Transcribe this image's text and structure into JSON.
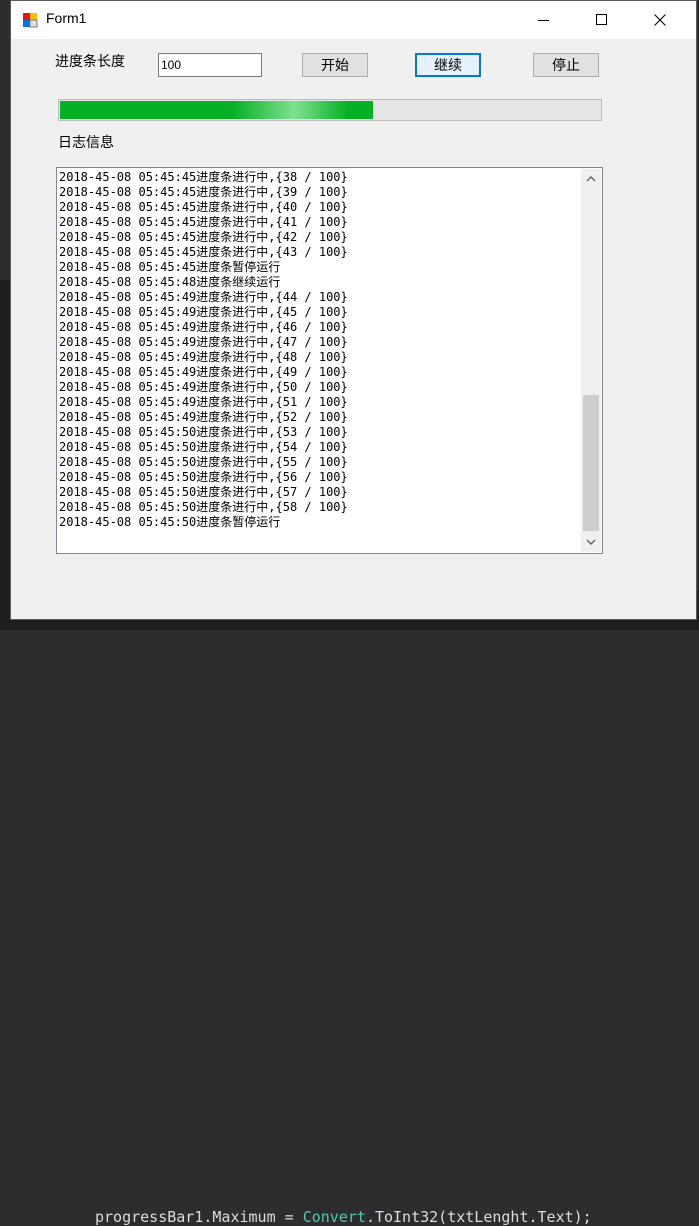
{
  "window": {
    "title": "Form1"
  },
  "controls": {
    "length_label": "进度条长度",
    "length_value": "100",
    "start_button": "开始",
    "continue_button": "继续",
    "stop_button": "停止",
    "log_label": "日志信息"
  },
  "progress": {
    "value": 58,
    "max": 100,
    "fraction": 0.58
  },
  "log": [
    "2018-45-08 05:45:45进度条进行中,{38 / 100}",
    "2018-45-08 05:45:45进度条进行中,{39 / 100}",
    "2018-45-08 05:45:45进度条进行中,{40 / 100}",
    "2018-45-08 05:45:45进度条进行中,{41 / 100}",
    "2018-45-08 05:45:45进度条进行中,{42 / 100}",
    "2018-45-08 05:45:45进度条进行中,{43 / 100}",
    "2018-45-08 05:45:45进度条暂停运行",
    "2018-45-08 05:45:48进度条继续运行",
    "2018-45-08 05:45:49进度条进行中,{44 / 100}",
    "2018-45-08 05:45:49进度条进行中,{45 / 100}",
    "2018-45-08 05:45:49进度条进行中,{46 / 100}",
    "2018-45-08 05:45:49进度条进行中,{47 / 100}",
    "2018-45-08 05:45:49进度条进行中,{48 / 100}",
    "2018-45-08 05:45:49进度条进行中,{49 / 100}",
    "2018-45-08 05:45:49进度条进行中,{50 / 100}",
    "2018-45-08 05:45:49进度条进行中,{51 / 100}",
    "2018-45-08 05:45:49进度条进行中,{52 / 100}",
    "2018-45-08 05:45:50进度条进行中,{53 / 100}",
    "2018-45-08 05:45:50进度条进行中,{54 / 100}",
    "2018-45-08 05:45:50进度条进行中,{55 / 100}",
    "2018-45-08 05:45:50进度条进行中,{56 / 100}",
    "2018-45-08 05:45:50进度条进行中,{57 / 100}",
    "2018-45-08 05:45:50进度条进行中,{58 / 100}",
    "2018-45-08 05:45:50进度条暂停运行"
  ],
  "background_code": {
    "prefix": "progressBar1.Maximum = ",
    "keyword": "Convert",
    "suffix": ".ToInt32(txtLenght.Text);"
  },
  "colors": {
    "progress_fill": "#06b025",
    "focus_border": "#0078d7"
  }
}
